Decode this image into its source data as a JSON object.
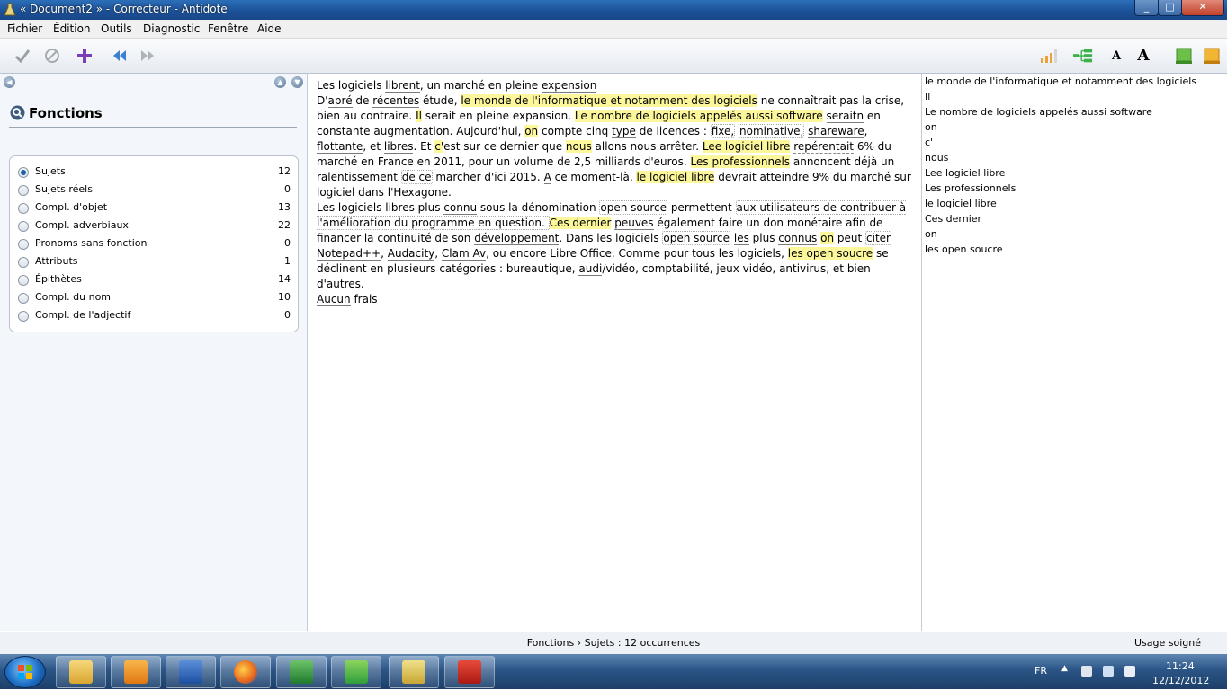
{
  "window": {
    "title": "« Document2 » - Correcteur - Antidote",
    "min": "_",
    "max": "□",
    "close": "✕"
  },
  "menu": [
    "Fichier",
    "Édition",
    "Outils",
    "Diagnostic",
    "Fenêtre",
    "Aide"
  ],
  "left_panel": {
    "title": "Fonctions",
    "items": [
      {
        "label": "Sujets",
        "count": "12",
        "selected": true
      },
      {
        "label": "Sujets réels",
        "count": "0"
      },
      {
        "label": "Compl. d'objet",
        "count": "13"
      },
      {
        "label": "Compl. adverbiaux",
        "count": "22"
      },
      {
        "label": "Pronoms sans fonction",
        "count": "0"
      },
      {
        "label": "Attributs",
        "count": "1"
      },
      {
        "label": "Épithètes",
        "count": "14"
      },
      {
        "label": "Compl. du nom",
        "count": "10"
      },
      {
        "label": "Compl. de l'adjectif",
        "count": "0"
      }
    ]
  },
  "document": {
    "p1": [
      "Les logiciels ",
      "librent",
      ", un marché en pleine ",
      "expension"
    ],
    "p2": [
      "D'",
      "apré",
      " de ",
      "récentes",
      " étude, ",
      "le monde de l'informatique et notamment des logiciels",
      " ne connaîtrait pas la crise, bien au contraire. ",
      "Il",
      " serait en pleine expansion. ",
      "Le nombre de logiciels appelés aussi software",
      " ",
      "seraitn",
      " en constante augmentation. Aujourd'hui, ",
      "on",
      " compte cinq ",
      "type",
      " de licences : ",
      "fixe,",
      " ",
      "nominative,",
      " ",
      "shareware",
      ", ",
      "flottante",
      ", et ",
      "libres",
      ". Et ",
      "c'",
      "est sur ce dernier que ",
      "nous",
      " allons nous arrêter. ",
      "Lee logiciel libre",
      " ",
      "repérentait",
      " 6% du marché en France en 2011, pour un volume de 2,5 milliards d'euros. ",
      "Les professionnels",
      " annoncent déjà un ralentissement ",
      "de ce",
      " marcher d'ici 2015. ",
      "A",
      " ce moment-là, ",
      "le logiciel libre",
      " devrait atteindre 9% du marché sur logiciel dans l'Hexagone."
    ],
    "p3": [
      "Les logiciels libres plus ",
      "connu",
      " sous la dénomination ",
      "open source",
      " permettent ",
      "aux utilisateurs de contribuer à l'amélioration du programme en question. ",
      "Ces dernier",
      " ",
      "peuves",
      " également faire un don monétaire afin de financer la continuité de son ",
      "développement",
      ". Dans les logiciels ",
      "open source",
      " ",
      "les",
      " plus ",
      "connus",
      " ",
      "on",
      " peut ",
      "citer ",
      "Notepad++",
      ", ",
      "Audacity",
      ", ",
      "Clam Av",
      ", ou encore Libre Office. Comme pour tous les logiciels, ",
      "les open soucre",
      " se déclinent en plusieurs catégories : bureautique, ",
      "audi",
      "/vidéo, comptabilité, jeux vidéo, antivirus, et bien d'autres."
    ],
    "p4": [
      "Aucun",
      " frais"
    ]
  },
  "occurrences": [
    "le monde de l'informatique et notamment des logiciels",
    "Il",
    "Le nombre de logiciels appelés aussi software",
    "on",
    "c'",
    "nous",
    "Lee logiciel libre",
    "Les professionnels",
    "le logiciel libre",
    "Ces dernier",
    "on",
    "les open soucre"
  ],
  "status": {
    "center": "Fonctions › Sujets : 12 occurrences",
    "right": "Usage soigné"
  },
  "taskbar": {
    "lang": "FR",
    "time": "11:24",
    "date": "12/12/2012"
  },
  "colors": {
    "highlight": "#fdf79b",
    "titlebar": "#1b4f95"
  }
}
